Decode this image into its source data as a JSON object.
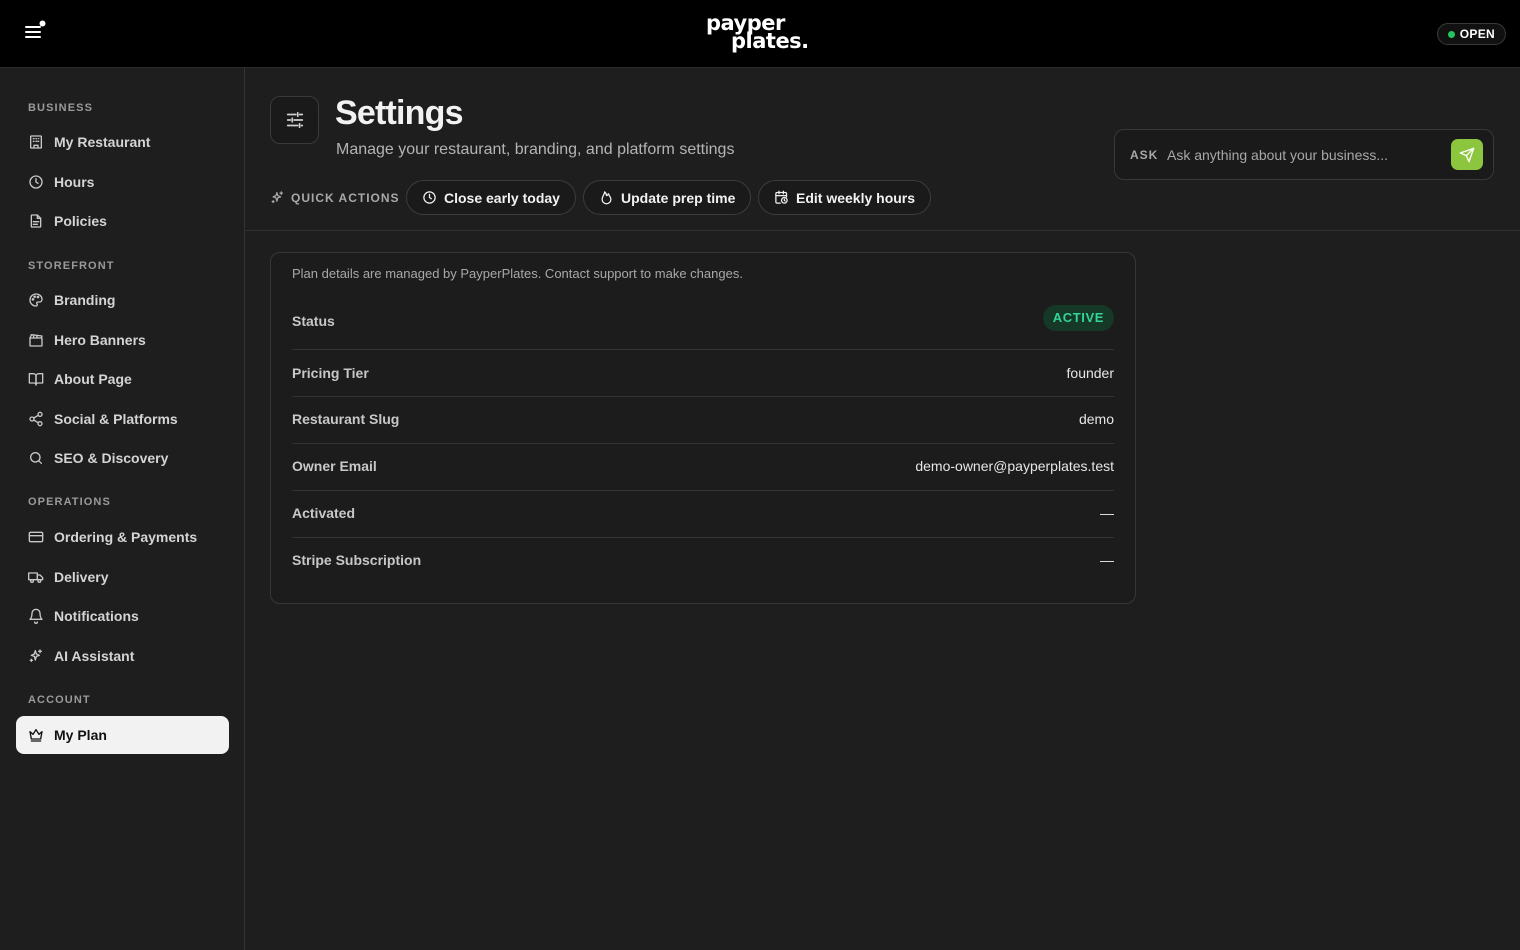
{
  "header": {
    "logo_line1": "payper",
    "logo_line2": "plates.",
    "status_label": "OPEN",
    "status_color": "#22c55e"
  },
  "sidebar": {
    "sections": [
      {
        "label": "BUSINESS",
        "items": [
          {
            "label": "My Restaurant",
            "icon": "building-icon"
          },
          {
            "label": "Hours",
            "icon": "clock-icon"
          },
          {
            "label": "Policies",
            "icon": "document-icon"
          }
        ]
      },
      {
        "label": "STOREFRONT",
        "items": [
          {
            "label": "Branding",
            "icon": "palette-icon"
          },
          {
            "label": "Hero Banners",
            "icon": "clapperboard-icon"
          },
          {
            "label": "About Page",
            "icon": "book-icon"
          },
          {
            "label": "Social & Platforms",
            "icon": "share-icon"
          },
          {
            "label": "SEO & Discovery",
            "icon": "search-icon"
          }
        ]
      },
      {
        "label": "OPERATIONS",
        "items": [
          {
            "label": "Ordering & Payments",
            "icon": "credit-card-icon"
          },
          {
            "label": "Delivery",
            "icon": "truck-icon"
          },
          {
            "label": "Notifications",
            "icon": "bell-icon"
          },
          {
            "label": "AI Assistant",
            "icon": "sparkles-icon"
          }
        ]
      },
      {
        "label": "ACCOUNT",
        "items": [
          {
            "label": "My Plan",
            "icon": "crown-icon",
            "active": true
          }
        ]
      }
    ]
  },
  "page": {
    "title": "Settings",
    "subtitle": "Manage your restaurant, branding, and platform settings"
  },
  "ask": {
    "label": "ASK",
    "placeholder": "Ask anything about your business...",
    "send_color": "#8cc63f"
  },
  "quick_actions": {
    "label": "QUICK ACTIONS",
    "buttons": [
      {
        "label": "Close early today",
        "icon": "clock-icon"
      },
      {
        "label": "Update prep time",
        "icon": "flame-icon"
      },
      {
        "label": "Edit weekly hours",
        "icon": "calendar-clock-icon"
      }
    ]
  },
  "plan": {
    "note": "Plan details are managed by PayperPlates. Contact support to make changes.",
    "status_key": "Status",
    "status_value": "ACTIVE",
    "status_color": "#34d399",
    "rows": [
      {
        "key": "Pricing Tier",
        "value": "founder"
      },
      {
        "key": "Restaurant Slug",
        "value": "demo"
      },
      {
        "key": "Owner Email",
        "value": "demo-owner@payperplates.test"
      },
      {
        "key": "Activated",
        "value": "—"
      },
      {
        "key": "Stripe Subscription",
        "value": "—"
      }
    ]
  }
}
